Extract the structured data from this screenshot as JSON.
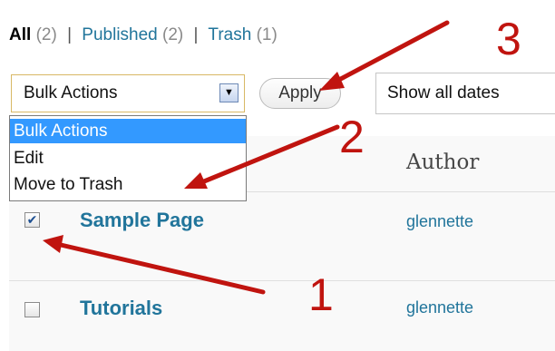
{
  "filters": {
    "all_label": "All",
    "all_count": "(2)",
    "published_label": "Published",
    "published_count": "(2)",
    "trash_label": "Trash",
    "trash_count": "(1)",
    "separator": "|"
  },
  "bulk_actions": {
    "selected": "Bulk Actions",
    "options": [
      "Bulk Actions",
      "Edit",
      "Move to Trash"
    ],
    "highlighted_index": 0
  },
  "apply_label": "Apply",
  "date_filter": {
    "selected": "Show all dates"
  },
  "table": {
    "author_header": "Author",
    "rows": [
      {
        "title": "Sample Page",
        "author": "glennette",
        "checked": true
      },
      {
        "title": "Tutorials",
        "author": "glennette",
        "checked": false
      }
    ]
  },
  "annotations": {
    "step1": "1",
    "step2": "2",
    "step3": "3",
    "color": "#c0140f"
  },
  "colors": {
    "link": "#21759b",
    "highlight": "#3399ff",
    "select_border": "#d8b865"
  }
}
